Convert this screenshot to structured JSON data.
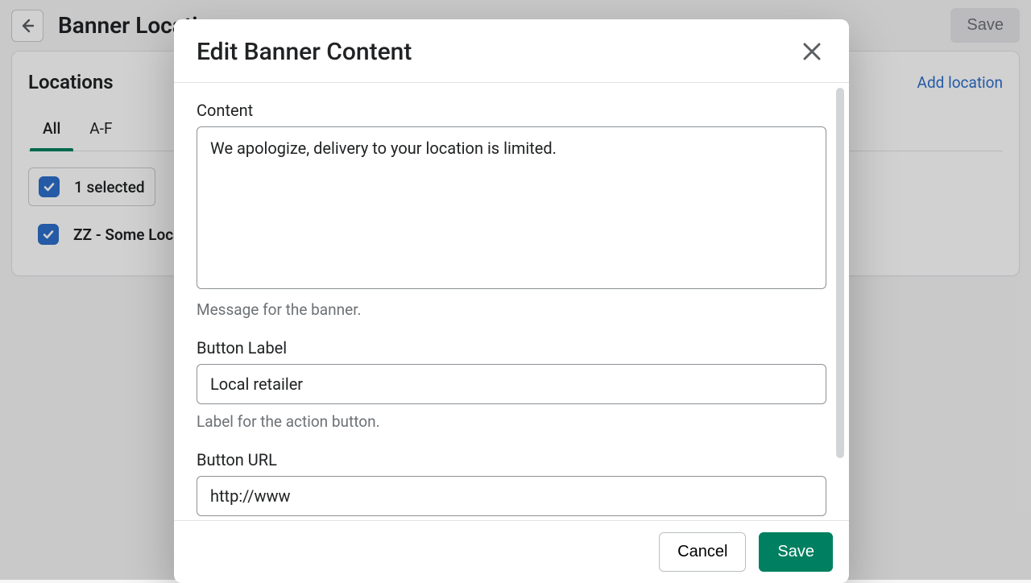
{
  "page": {
    "title": "Banner Locations",
    "save_button": "Save"
  },
  "locations": {
    "title": "Locations",
    "add_link": "Add location",
    "tabs": [
      {
        "label": "All",
        "active": true
      },
      {
        "label": "A-F",
        "active": false
      }
    ],
    "selection_text": "1 selected",
    "rows": [
      {
        "label": "ZZ - Some Location",
        "checked": true
      }
    ]
  },
  "modal": {
    "title": "Edit Banner Content",
    "fields": {
      "content": {
        "label": "Content",
        "value": "We apologize, delivery to your location is limited.",
        "help": "Message for the banner."
      },
      "button_label": {
        "label": "Button Label",
        "value": "Local retailer",
        "help": "Label for the action button."
      },
      "button_url": {
        "label": "Button URL",
        "value": "http://www"
      }
    },
    "footer": {
      "cancel": "Cancel",
      "save": "Save"
    }
  }
}
